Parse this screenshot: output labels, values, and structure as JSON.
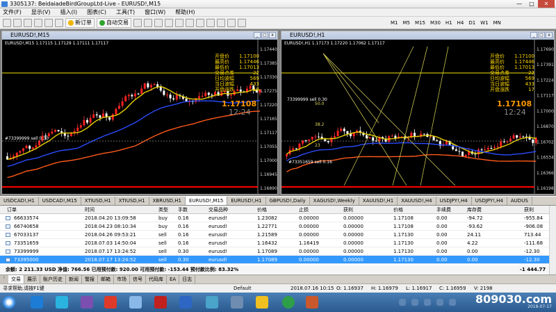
{
  "window": {
    "title": "3305137: BeidaiadeBirdGroupLtd-Live - EURUSD!,M15",
    "minimize": "—",
    "maximize": "□",
    "close": "✕"
  },
  "menu": [
    "文件(F)",
    "显示(V)",
    "插入(I)",
    "图表(C)",
    "工具(T)",
    "窗口(W)",
    "帮助(H)"
  ],
  "toolbar": {
    "new_order": "新订单",
    "autotrade": "自动交易",
    "timeframes": [
      "M1",
      "M5",
      "M15",
      "M30",
      "H1",
      "H4",
      "D1",
      "W1",
      "MN"
    ]
  },
  "chart_left": {
    "title": "EURUSD!,M15",
    "info": "EURUSD!,M15  1.17115 1.17129 1.17111 1.17117",
    "indicator": [
      {
        "label": "开盘价",
        "value": "1.17100"
      },
      {
        "label": "最高价",
        "value": "1.17446"
      },
      {
        "label": "最低价",
        "value": "1.17013"
      },
      {
        "label": "交易点差",
        "value": "22"
      },
      {
        "label": "日均波幅",
        "value": "569"
      },
      {
        "label": "当日波幅",
        "value": "433"
      },
      {
        "label": "开盘涨跌",
        "value": "17"
      }
    ],
    "price": "1.17108",
    "clock": "12:24",
    "order_label": "#73399999 sell 0.30",
    "yaxis": [
      "1.17440",
      "1.17385",
      "1.17330",
      "1.17275",
      "1.17220",
      "1.17165",
      "1.17117",
      "1.17055",
      "1.17000",
      "1.16945",
      "1.16890"
    ]
  },
  "chart_right": {
    "title": "EURUSD!,H1",
    "info": "EURUSD!,H1  1.17173 1.17220 1.17062 1.17117",
    "indicator": [
      {
        "label": "开盘价",
        "value": "1.17100"
      },
      {
        "label": "最高价",
        "value": "1.17446"
      },
      {
        "label": "最低价",
        "value": "1.17013"
      },
      {
        "label": "交易点差",
        "value": "22"
      },
      {
        "label": "日均波幅",
        "value": "569"
      },
      {
        "label": "当日波幅",
        "value": "433"
      },
      {
        "label": "开盘涨跌",
        "value": "17"
      }
    ],
    "price": "1.17108",
    "clock": "12:24",
    "order_label": "#73351659 sell 0.16",
    "order_label_top": "73399999 sell 0.30",
    "fibo": [
      "50.0",
      "38.2",
      "23"
    ],
    "yaxis": [
      "1.17690",
      "1.17391",
      "1.17224",
      "1.17117",
      "1.17000",
      "1.16870",
      "1.16702",
      "1.16534",
      "1.16366",
      "1.16198"
    ]
  },
  "chart_tabs": [
    "USDCAD!,H1",
    "USDCAD!,M15",
    "XTIUSD,H1",
    "XTIUSD,H1",
    "XBRUSD,H1",
    "EURUSD!,M15",
    "EURUSD!,H1",
    "GBPUSD!,Daily",
    "XAGUSD!,Weekly",
    "XAUUSD!,H1",
    "XAUUSD!,H4",
    "USDJPY!,H4",
    "USDJPY!,H4",
    "AUDUS"
  ],
  "terminal": {
    "headers": [
      "订单",
      "时间",
      "类型",
      "手数",
      "交易品种",
      "价格",
      "止损",
      "获利",
      "价格",
      "手续费",
      "库存费",
      "获利"
    ],
    "rows": [
      [
        "66633574",
        "2018.04.20 13:09:58",
        "buy",
        "0.16",
        "eurusd!",
        "1.23082",
        "0.00000",
        "0.00000",
        "1.17108",
        "0.00",
        "-94.72",
        "-955.84"
      ],
      [
        "66740658",
        "2018.04.23 08:10:34",
        "buy",
        "0.16",
        "eurusd!",
        "1.22771",
        "0.00000",
        "0.00000",
        "1.17108",
        "0.00",
        "-93.62",
        "-906.08"
      ],
      [
        "67033137",
        "2018.04.26 09:53:21",
        "sell",
        "0.16",
        "eurusd!",
        "1.21589",
        "0.00000",
        "0.00000",
        "1.17130",
        "0.00",
        "24.11",
        "713.44"
      ],
      [
        "73351659",
        "2018.07.03 14:50:04",
        "sell",
        "0.16",
        "eurusd!",
        "1.16432",
        "1.16419",
        "0.00000",
        "1.17130",
        "0.00",
        "4.22",
        "-111.68"
      ],
      [
        "73399999",
        "2018.07.17 13:24:52",
        "sell",
        "0.30",
        "eurusd!",
        "1.17089",
        "0.00000",
        "0.00000",
        "1.17130",
        "0.00",
        "0.00",
        "-12.30"
      ],
      [
        "73395000",
        "2018.07.17 13:24:52",
        "sell",
        "0.30",
        "eurusd!",
        "1.17089",
        "0.00000",
        "0.00000",
        "1.17130",
        "0.00",
        "0.00",
        "-12.30"
      ]
    ],
    "balance": "余额: 2 211.33 USD  净值: 766.56  已用预付款: 920.00  可用预付款: -153.44  预付款比例: 83.32%",
    "total": "-1 444.77"
  },
  "terminal_tabs": [
    "交易",
    "展示",
    "账户历史",
    "新闻",
    "警报",
    "邮箱",
    "市场",
    "信号",
    "代码库",
    "EA",
    "日志"
  ],
  "status": {
    "help": "寻求帮助,请按F1键",
    "profile": "Default",
    "datetime": "2018.07.16 10:15",
    "open": "O: 1.16937",
    "high": "H: 1.16979",
    "low": "L: 1.16917",
    "close": "C: 1.16959",
    "volume": "V: 2198"
  },
  "taskbar": {
    "watermark": "809030.com",
    "date": "2018-07-17"
  }
}
